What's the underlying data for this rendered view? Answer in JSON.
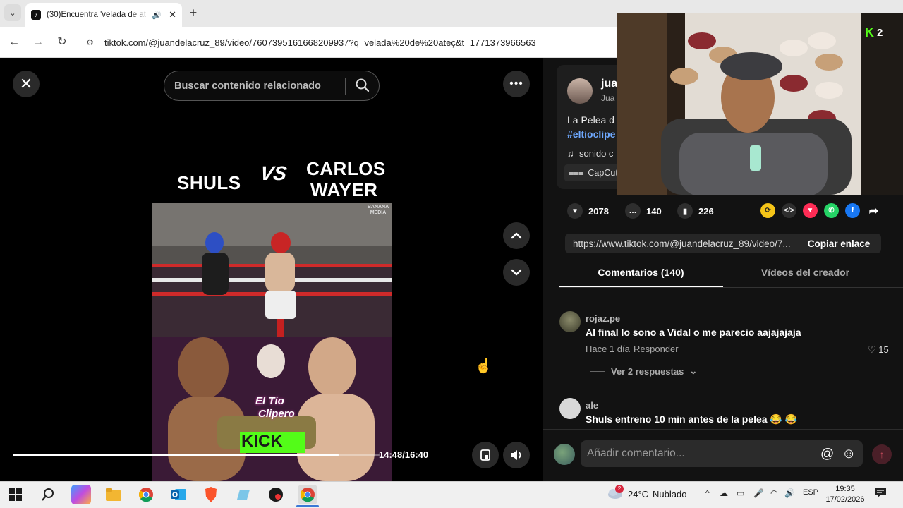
{
  "browser": {
    "tab_title": "(30)Encuentra 'velada de at",
    "new_tab": "+",
    "close": "✕",
    "url": "tiktok.com/@juandelacruz_89/video/7607395161668209937?q=velada%20de%20ateç&t=1771373966563"
  },
  "video": {
    "search_placeholder": "Buscar contenido relacionado",
    "fighter_left": "SHULS",
    "versus": "VS",
    "fighter_right_1": "CARLOS",
    "fighter_right_2": "WAYER",
    "watermark": "BANANA MEDIA",
    "poster_logo_1": "El Tío",
    "poster_logo_2": "Clipero",
    "poster_kick": "KICK",
    "time": "14:48/16:40",
    "progress_fraction": 0.888
  },
  "description": {
    "author": "jua",
    "author_sub": "Jua",
    "text": "La Pelea d",
    "hashtag": "#eltioclipe",
    "sound": "sonido c",
    "capcut": "CapCut -"
  },
  "stream": {
    "viewers": "2"
  },
  "stats": {
    "likes": "2078",
    "comments": "140",
    "saves": "226"
  },
  "share": {
    "link": "https://www.tiktok.com/@juandelacruz_89/video/7...",
    "copy_label": "Copiar enlace"
  },
  "tabs": {
    "comments": "Comentarios (140)",
    "creator": "Vídeos del creador"
  },
  "comments": [
    {
      "user": "rojaz.pe",
      "text": "Al final lo sono a Vidal o me parecio aajajajaja",
      "time": "Hace 1 día",
      "reply": "Responder",
      "likes": "15",
      "replies": "Ver 2 respuestas"
    },
    {
      "user": "ale",
      "text": "Shuls entreno 10 min antes de la pelea 😂 😂"
    }
  ],
  "comment_input": {
    "placeholder": "Añadir comentario..."
  },
  "taskbar": {
    "weather_temp": "24°C",
    "weather_text": "Nublado",
    "weather_badge": "2",
    "lang": "ESP",
    "time": "19:35",
    "date": "17/02/2026"
  },
  "colors": {
    "kick_green": "#53fc18",
    "tiktok_red": "#fe2c55",
    "link_blue": "#6fa9ff"
  }
}
